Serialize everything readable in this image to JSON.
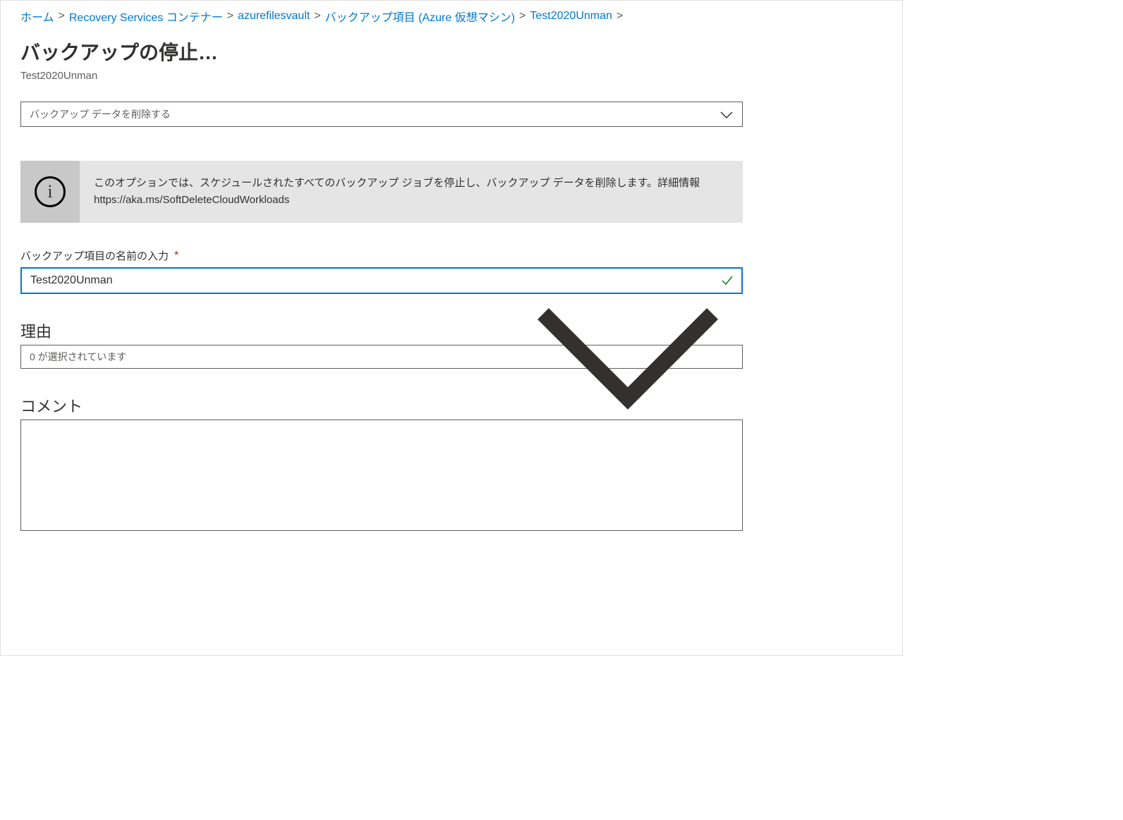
{
  "breadcrumb": {
    "home": "ホーム",
    "rsv_containers": "Recovery Services コンテナー",
    "vault": "azurefilesvault",
    "backup_items": "バックアップ項目 (Azure 仮想マシン)",
    "item": "Test2020Unman"
  },
  "page": {
    "title": "バックアップの停止…",
    "subtitle": "Test2020Unman"
  },
  "action_dropdown": {
    "selected": "バックアップ データを削除する"
  },
  "info_banner": {
    "text": "このオプションでは、スケジュールされたすべてのバックアップ ジョブを停止し、バックアップ データを削除します。詳細情報",
    "url": "https://aka.ms/SoftDeleteCloudWorkloads"
  },
  "fields": {
    "name_label": "バックアップ項目の名前の入力",
    "name_value": "Test2020Unman",
    "reason_heading": "理由",
    "reason_selected": "0 が選択されています",
    "comment_heading": "コメント"
  }
}
